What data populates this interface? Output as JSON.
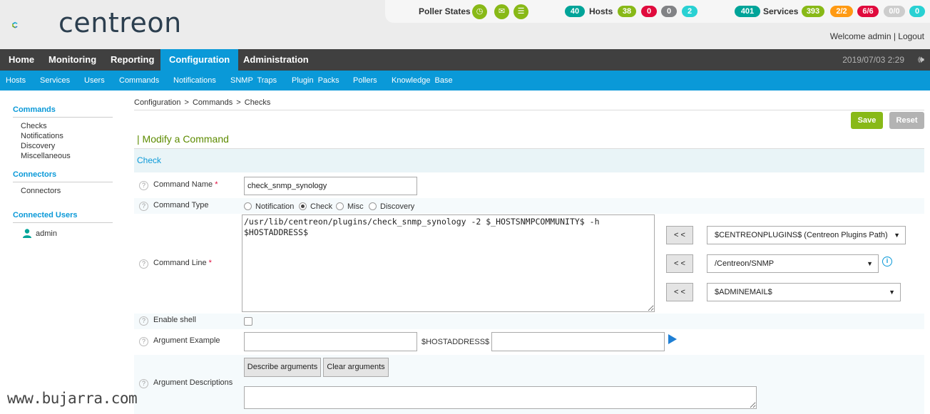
{
  "header": {
    "logo_text": "centreon",
    "poller_states_label": "Poller States",
    "hosts_label": "Hosts",
    "services_label": "Services",
    "host_counts": [
      "40",
      "38",
      "0",
      "0",
      "2"
    ],
    "service_counts": [
      "401",
      "393",
      "2/2",
      "6/6",
      "0/0",
      "0"
    ],
    "welcome": "Welcome admin | Logout"
  },
  "main_nav": {
    "items": [
      "Home",
      "Monitoring",
      "Reporting",
      "Configuration",
      "Administration"
    ],
    "active": "Configuration",
    "datetime": "2019/07/03 2:29"
  },
  "sub_nav": {
    "items": [
      "Hosts",
      "Services",
      "Users",
      "Commands",
      "Notifications",
      "SNMP Traps",
      "Plugin Packs",
      "Pollers",
      "Knowledge Base"
    ]
  },
  "sidebar": {
    "sections": [
      {
        "title": "Commands",
        "items": [
          "Checks",
          "Notifications",
          "Discovery",
          "Miscellaneous"
        ]
      },
      {
        "title": "Connectors",
        "items": [
          "Connectors"
        ]
      },
      {
        "title": "Connected Users",
        "items": [
          "admin"
        ]
      }
    ]
  },
  "breadcrumb": "Configuration  >  Commands  >  Checks",
  "buttons": {
    "save": "Save",
    "reset": "Reset"
  },
  "form": {
    "title": "| Modify a Command",
    "section": "Check",
    "command_name_label": "Command Name",
    "command_name_value": "check_snmp_synology",
    "command_type_label": "Command Type",
    "command_types": [
      "Notification",
      "Check",
      "Misc",
      "Discovery"
    ],
    "command_type_selected": "Check",
    "command_line_label": "Command Line",
    "command_line_value": "/usr/lib/centreon/plugins/check_snmp_synology -2 $_HOSTSNMPCOMMUNITY$ -h $HOSTADDRESS$",
    "insert_button": "< <",
    "selects": [
      "$CENTREONPLUGINS$ (Centreon Plugins Path)",
      "/Centreon/SNMP",
      "$ADMINEMAIL$"
    ],
    "enable_shell_label": "Enable shell",
    "argument_example_label": "Argument Example",
    "argument_example_value": "",
    "hostaddress_label": "$HOSTADDRESS$",
    "hostaddress_value": "",
    "describe_arguments": "Describe arguments",
    "clear_arguments": "Clear arguments",
    "argument_descriptions_label": "Argument Descriptions",
    "required_mark": "*"
  },
  "watermark": "www.bujarra.com",
  "colors": {
    "brand_blue": "#0a99d8",
    "nav_dark": "#404040",
    "save_green": "#88b917",
    "teal": "#00a499"
  }
}
